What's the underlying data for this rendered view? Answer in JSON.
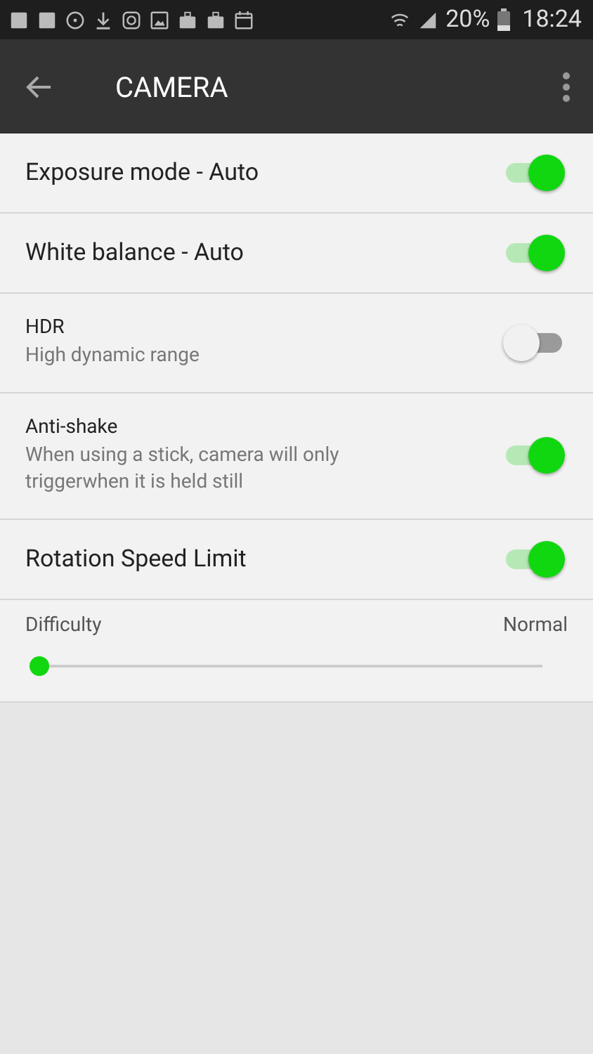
{
  "status_bar": {
    "battery": "20%",
    "time": "18:24"
  },
  "header": {
    "title": "CAMERA"
  },
  "settings": [
    {
      "kind": "large",
      "title": "Exposure mode - Auto",
      "on": true
    },
    {
      "kind": "large",
      "title": "White balance - Auto",
      "on": true
    },
    {
      "kind": "small",
      "title": "HDR",
      "subtitle": "High dynamic range",
      "on": false
    },
    {
      "kind": "small",
      "title": "Anti-shake",
      "subtitle": "When using a stick, camera will only triggerwhen it is held still",
      "on": true
    },
    {
      "kind": "large",
      "title": "Rotation Speed Limit",
      "on": true
    }
  ],
  "slider": {
    "label": "Difficulty",
    "reading": "Normal",
    "level": 0
  }
}
